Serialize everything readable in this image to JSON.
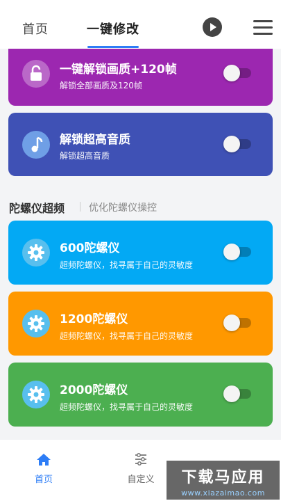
{
  "header": {
    "tabs": [
      {
        "label": "首页"
      },
      {
        "label": "一键修改"
      }
    ]
  },
  "cards": [
    {
      "title": "一键解锁画质+120帧",
      "subtitle": "解锁全部画质及120帧",
      "icon": "unlock-icon",
      "color": "#9c27b0",
      "enabled": false
    },
    {
      "title": "解锁超高音质",
      "subtitle": "解锁超高音质",
      "icon": "music-note-icon",
      "color": "#3f51b5",
      "enabled": false
    }
  ],
  "section": {
    "title": "陀螺仪超频",
    "subtitle": "优化陀螺仪操控"
  },
  "gyro_cards": [
    {
      "title": "600陀螺仪",
      "subtitle": "超频陀螺仪，找寻属于自己的灵敏度",
      "icon": "gear-icon",
      "color": "#03a9f4",
      "enabled": false
    },
    {
      "title": "1200陀螺仪",
      "subtitle": "超频陀螺仪，找寻属于自己的灵敏度",
      "icon": "gear-icon",
      "color": "#ff9800",
      "enabled": false
    },
    {
      "title": "2000陀螺仪",
      "subtitle": "超频陀螺仪，找寻属于自己的灵敏度",
      "icon": "gear-icon",
      "color": "#4caf50",
      "enabled": false
    }
  ],
  "bottom_nav": [
    {
      "label": "首页",
      "icon": "home-icon",
      "active": true
    },
    {
      "label": "自定义",
      "icon": "sliders-icon",
      "active": false
    }
  ],
  "watermark": {
    "logo": "下载马应用",
    "url": "www.xiazaimao.com"
  },
  "colors": {
    "accent": "#2d7df6"
  }
}
